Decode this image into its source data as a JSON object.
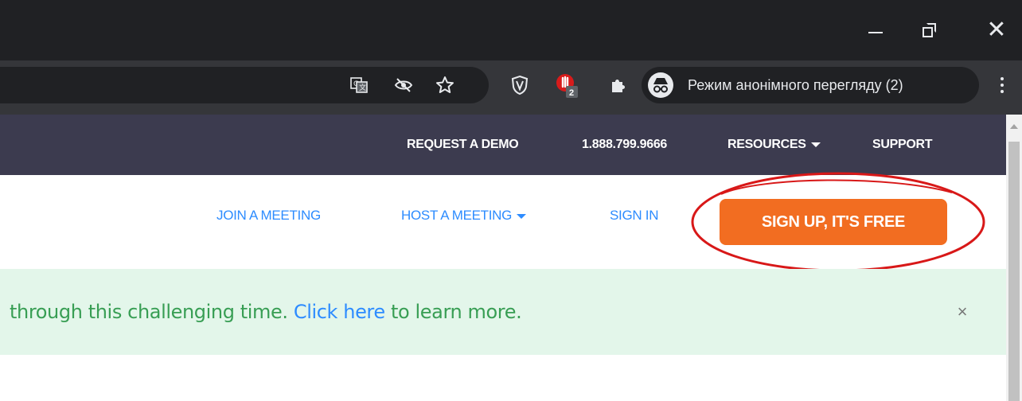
{
  "browser": {
    "controls": {
      "minimize_icon": "minimize-icon",
      "restore_icon": "restore-icon",
      "close_icon": "close-icon",
      "close_glyph": "✕"
    },
    "toolbar": {
      "icons": [
        "translate-icon",
        "tracking-protection-icon",
        "star-icon",
        "shield-extension-icon",
        "adblock-extension-icon",
        "extensions-puzzle-icon",
        "incognito-icon",
        "menu-kebab-icon"
      ],
      "adblock_badge": "2",
      "incognito_label": "Режим анонімного перегляду (2)"
    }
  },
  "topnav": {
    "items": [
      "REQUEST A DEMO",
      "1.888.799.9666",
      "RESOURCES",
      "SUPPORT"
    ],
    "background": "#3c3b4f"
  },
  "mainnav": {
    "join": "JOIN A MEETING",
    "host": "HOST A MEETING",
    "signin": "SIGN IN",
    "signup": "SIGN UP, IT'S FREE",
    "accent": "#2d8cff",
    "signup_color": "#f26d21"
  },
  "banner": {
    "before": "through this challenging time. ",
    "link": "Click here",
    "after": " to learn more.",
    "close": "×",
    "background": "#e3f6ea"
  }
}
